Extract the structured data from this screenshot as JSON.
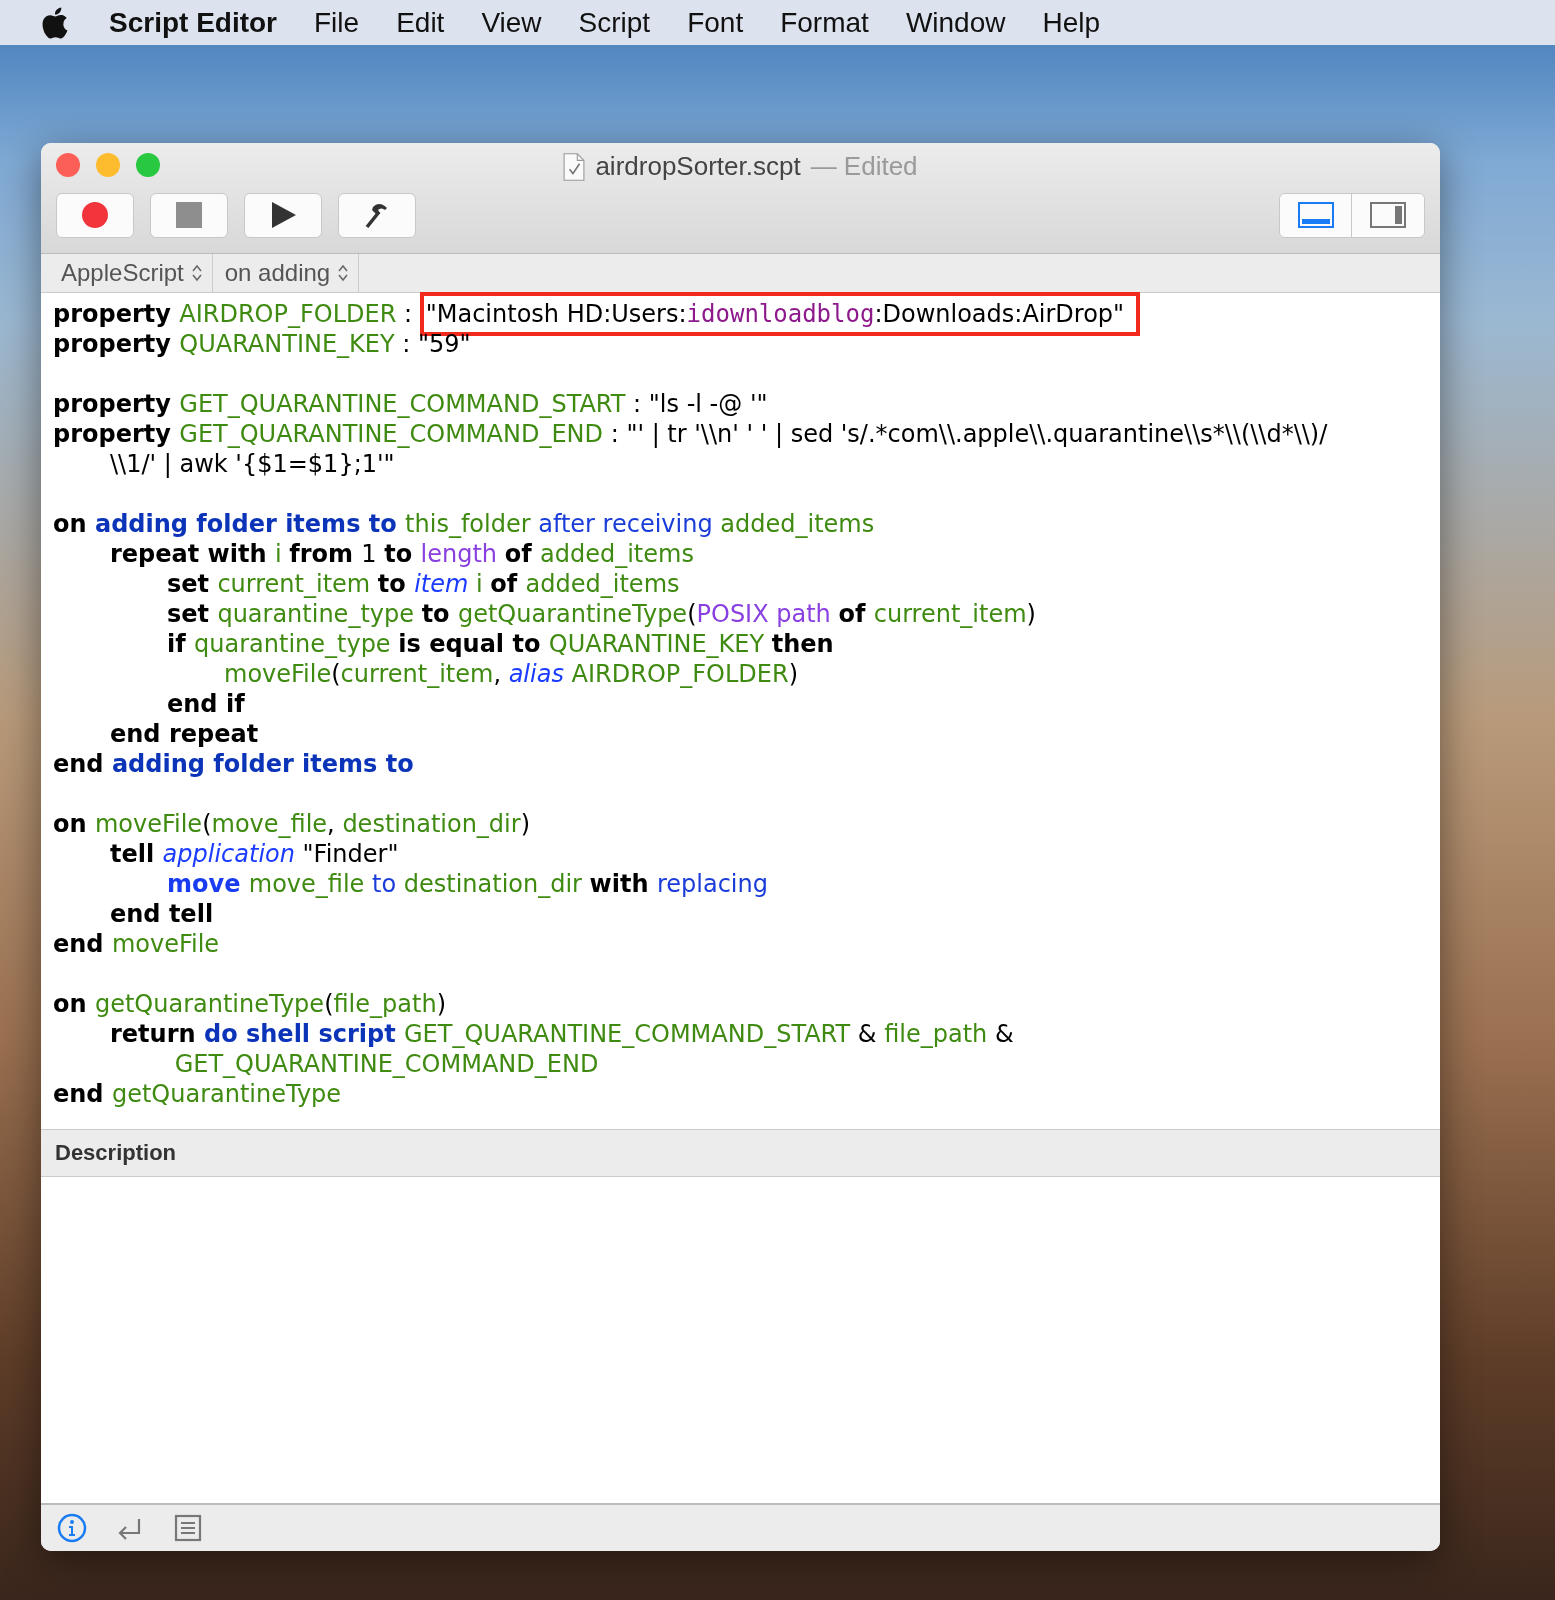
{
  "menu_bar": {
    "app_name": "Script Editor",
    "items": [
      "File",
      "Edit",
      "View",
      "Script",
      "Font",
      "Format",
      "Window",
      "Help"
    ]
  },
  "window": {
    "title": "airdropSorter.scpt",
    "status": "— Edited"
  },
  "toolbar": {
    "buttons": [
      {
        "kind": "record"
      },
      {
        "kind": "stop"
      },
      {
        "kind": "run"
      },
      {
        "kind": "compile"
      }
    ],
    "view_buttons": [
      {
        "kind": "bottom-pane",
        "selected": true
      },
      {
        "kind": "side-pane",
        "selected": false
      }
    ]
  },
  "navigation_bar": {
    "popups": [
      "AppleScript",
      "on adding"
    ]
  },
  "code": {
    "blocks": [
      [
        {
          "tokens": [
            {
              "kind": "kw",
              "text": "property "
            },
            {
              "kind": "var",
              "text": "AIRDROP_FOLDER"
            },
            {
              "kind": "plain",
              "text": " : "
            }
          ],
          "boxed": [
            {
              "kind": "plain",
              "text": "\"Macintosh HD:Users:"
            },
            {
              "kind": "mono",
              "text": "idownloadblog"
            },
            {
              "kind": "plain",
              "text": ":Downloads:AirDrop\""
            }
          ]
        },
        {
          "tokens": [
            {
              "kind": "kw",
              "text": "property "
            },
            {
              "kind": "var",
              "text": "QUARANTINE_KEY"
            },
            {
              "kind": "plain",
              "text": " : \"59\""
            }
          ]
        }
      ],
      [
        {
          "tokens": [
            {
              "kind": "kw",
              "text": "property "
            },
            {
              "kind": "var",
              "text": "GET_QUARANTINE_COMMAND_START"
            },
            {
              "kind": "plain",
              "text": " : \"ls -l -@ '\""
            }
          ]
        },
        {
          "tokens": [
            {
              "kind": "kw",
              "text": "property "
            },
            {
              "kind": "var",
              "text": "GET_QUARANTINE_COMMAND_END"
            },
            {
              "kind": "plain",
              "text": " : \"' | tr '\\\\n' ' ' | sed 's/.*com\\\\.apple\\\\.quarantine\\\\s*\\\\(\\\\d*\\\\)/"
            }
          ],
          "children": [
            {
              "tokens": [
                {
                  "kind": "plain",
                  "text": "\\\\1/' | awk '{$1=$1};1'\""
                }
              ]
            }
          ]
        }
      ],
      [
        {
          "tokens": [
            {
              "kind": "kw",
              "text": "on "
            },
            {
              "kind": "cmd",
              "text": "adding folder items to "
            },
            {
              "kind": "var",
              "text": "this_folder "
            },
            {
              "kind": "param",
              "text": "after receiving "
            },
            {
              "kind": "var",
              "text": "added_items"
            }
          ],
          "children": [
            {
              "tokens": [
                {
                  "kind": "kw",
                  "text": "repeat with "
                },
                {
                  "kind": "var",
                  "text": "i "
                },
                {
                  "kind": "kw",
                  "text": "from "
                },
                {
                  "kind": "plain",
                  "text": "1 "
                },
                {
                  "kind": "kw",
                  "text": "to "
                },
                {
                  "kind": "prop",
                  "text": "length "
                },
                {
                  "kind": "kw",
                  "text": "of "
                },
                {
                  "kind": "var",
                  "text": "added_items"
                }
              ],
              "children": [
                {
                  "tokens": [
                    {
                      "kind": "kw",
                      "text": "set "
                    },
                    {
                      "kind": "var",
                      "text": "current_item "
                    },
                    {
                      "kind": "kw",
                      "text": "to "
                    },
                    {
                      "kind": "cls",
                      "text": "item "
                    },
                    {
                      "kind": "var",
                      "text": "i "
                    },
                    {
                      "kind": "kw",
                      "text": "of "
                    },
                    {
                      "kind": "var",
                      "text": "added_items"
                    }
                  ]
                },
                {
                  "tokens": [
                    {
                      "kind": "kw",
                      "text": "set "
                    },
                    {
                      "kind": "var",
                      "text": "quarantine_type "
                    },
                    {
                      "kind": "kw",
                      "text": "to "
                    },
                    {
                      "kind": "var",
                      "text": "getQuarantineType"
                    },
                    {
                      "kind": "plain",
                      "text": "("
                    },
                    {
                      "kind": "prop",
                      "text": "POSIX path "
                    },
                    {
                      "kind": "kw",
                      "text": "of "
                    },
                    {
                      "kind": "var",
                      "text": "current_item"
                    },
                    {
                      "kind": "plain",
                      "text": ")"
                    }
                  ]
                },
                {
                  "tokens": [
                    {
                      "kind": "kw",
                      "text": "if "
                    },
                    {
                      "kind": "var",
                      "text": "quarantine_type "
                    },
                    {
                      "kind": "kw",
                      "text": "is equal to "
                    },
                    {
                      "kind": "var",
                      "text": "QUARANTINE_KEY "
                    },
                    {
                      "kind": "kw",
                      "text": "then"
                    }
                  ],
                  "children": [
                    {
                      "tokens": [
                        {
                          "kind": "var",
                          "text": "moveFile"
                        },
                        {
                          "kind": "plain",
                          "text": "("
                        },
                        {
                          "kind": "var",
                          "text": "current_item"
                        },
                        {
                          "kind": "plain",
                          "text": ", "
                        },
                        {
                          "kind": "cls",
                          "text": "alias "
                        },
                        {
                          "kind": "var",
                          "text": "AIRDROP_FOLDER"
                        },
                        {
                          "kind": "plain",
                          "text": ")"
                        }
                      ]
                    }
                  ]
                },
                {
                  "tokens": [
                    {
                      "kind": "kw",
                      "text": "end if"
                    }
                  ]
                }
              ]
            },
            {
              "tokens": [
                {
                  "kind": "kw",
                  "text": "end repeat"
                }
              ]
            }
          ]
        },
        {
          "tokens": [
            {
              "kind": "kw",
              "text": "end "
            },
            {
              "kind": "cmd",
              "text": "adding folder items to"
            }
          ]
        }
      ],
      [
        {
          "tokens": [
            {
              "kind": "kw",
              "text": "on "
            },
            {
              "kind": "var",
              "text": "moveFile"
            },
            {
              "kind": "plain",
              "text": "("
            },
            {
              "kind": "var",
              "text": "move_file"
            },
            {
              "kind": "plain",
              "text": ", "
            },
            {
              "kind": "var",
              "text": "destination_dir"
            },
            {
              "kind": "plain",
              "text": ")"
            }
          ],
          "children": [
            {
              "tokens": [
                {
                  "kind": "kw",
                  "text": "tell "
                },
                {
                  "kind": "cls",
                  "text": "application"
                },
                {
                  "kind": "plain",
                  "text": " \"Finder\""
                }
              ],
              "children": [
                {
                  "tokens": [
                    {
                      "kind": "cmd2",
                      "text": "move "
                    },
                    {
                      "kind": "var",
                      "text": "move_file "
                    },
                    {
                      "kind": "param",
                      "text": "to "
                    },
                    {
                      "kind": "var",
                      "text": "destination_dir "
                    },
                    {
                      "kind": "kw",
                      "text": "with "
                    },
                    {
                      "kind": "param",
                      "text": "replacing"
                    }
                  ]
                }
              ]
            },
            {
              "tokens": [
                {
                  "kind": "kw",
                  "text": "end tell"
                }
              ]
            }
          ]
        },
        {
          "tokens": [
            {
              "kind": "kw",
              "text": "end "
            },
            {
              "kind": "var",
              "text": "moveFile"
            }
          ]
        }
      ],
      [
        {
          "tokens": [
            {
              "kind": "kw",
              "text": "on "
            },
            {
              "kind": "var",
              "text": "getQuarantineType"
            },
            {
              "kind": "plain",
              "text": "("
            },
            {
              "kind": "var",
              "text": "file_path"
            },
            {
              "kind": "plain",
              "text": ")"
            }
          ],
          "children": [
            {
              "tokens": [
                {
                  "kind": "kw",
                  "text": "return "
                },
                {
                  "kind": "cmd",
                  "text": "do shell script "
                },
                {
                  "kind": "var",
                  "text": "GET_QUARANTINE_COMMAND_START "
                },
                {
                  "kind": "plain",
                  "text": "& "
                },
                {
                  "kind": "var",
                  "text": "file_path "
                },
                {
                  "kind": "plain",
                  "text": "&"
                }
              ],
              "children": [
                {
                  "tokens": [
                    {
                      "kind": "var",
                      "text": " GET_QUARANTINE_COMMAND_END"
                    }
                  ]
                }
              ]
            }
          ]
        },
        {
          "tokens": [
            {
              "kind": "kw",
              "text": "end "
            },
            {
              "kind": "var",
              "text": "getQuarantineType"
            }
          ]
        }
      ]
    ]
  },
  "description": {
    "title": "Description"
  },
  "bottom_bar": {
    "buttons": [
      {
        "kind": "info",
        "selected": true
      },
      {
        "kind": "replies",
        "selected": false
      },
      {
        "kind": "log",
        "selected": false
      }
    ]
  }
}
